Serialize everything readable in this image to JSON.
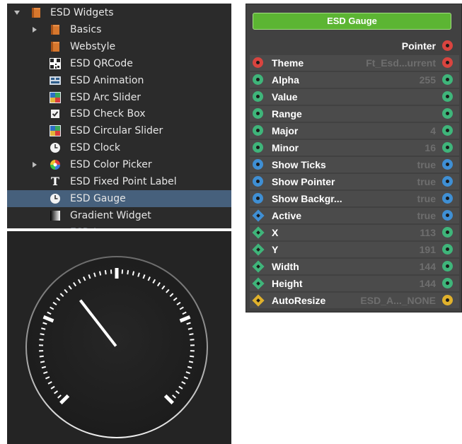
{
  "colors": {
    "red": "#d9443f",
    "green": "#3fb57a",
    "blue": "#3f8fd4",
    "yellow": "#e0b12c",
    "node_title": "#5cb533"
  },
  "tree": {
    "items": [
      {
        "label": "ESD Widgets",
        "icon": "book-icon",
        "arrow": "down",
        "level": 0
      },
      {
        "label": "Basics",
        "icon": "book-icon",
        "arrow": "right",
        "level": 1
      },
      {
        "label": "Webstyle",
        "icon": "book-icon",
        "arrow": "",
        "level": 1
      },
      {
        "label": "ESD QRCode",
        "icon": "qrcode-icon",
        "arrow": "",
        "level": 1
      },
      {
        "label": "ESD Animation",
        "icon": "animation-icon",
        "arrow": "",
        "level": 1
      },
      {
        "label": "ESD Arc Slider",
        "icon": "arc-slider-icon",
        "arrow": "",
        "level": 1
      },
      {
        "label": "ESD Check Box",
        "icon": "checkbox-icon",
        "arrow": "",
        "level": 1
      },
      {
        "label": "ESD Circular Slider",
        "icon": "circular-slider-icon",
        "arrow": "",
        "level": 1
      },
      {
        "label": "ESD Clock",
        "icon": "clock-icon",
        "arrow": "",
        "level": 1
      },
      {
        "label": "ESD Color Picker",
        "icon": "color-wheel-icon",
        "arrow": "right",
        "level": 1
      },
      {
        "label": "ESD Fixed Point Label",
        "icon": "text-icon",
        "arrow": "",
        "level": 1
      },
      {
        "label": "ESD Gauge",
        "icon": "gauge-icon",
        "arrow": "",
        "level": 1,
        "selected": true
      },
      {
        "label": "Gradient Widget",
        "icon": "gradient-icon",
        "arrow": "",
        "level": 1
      }
    ],
    "partial_label": "ESD L..."
  },
  "node": {
    "title": "ESD Gauge",
    "output": {
      "label": "Pointer",
      "port": "red"
    },
    "properties": [
      {
        "name": "Theme",
        "value": "Ft_Esd...urrent",
        "port": "red",
        "shape": "circle"
      },
      {
        "name": "Alpha",
        "value": "255",
        "port": "green",
        "shape": "circle"
      },
      {
        "name": "Value",
        "value": "",
        "port": "green",
        "shape": "circle"
      },
      {
        "name": "Range",
        "value": "",
        "port": "green",
        "shape": "circle"
      },
      {
        "name": "Major",
        "value": "4",
        "port": "green",
        "shape": "circle"
      },
      {
        "name": "Minor",
        "value": "16",
        "port": "green",
        "shape": "circle"
      },
      {
        "name": "Show Ticks",
        "value": "true",
        "port": "blue",
        "shape": "circle"
      },
      {
        "name": "Show Pointer",
        "value": "true",
        "port": "blue",
        "shape": "circle"
      },
      {
        "name": "Show Backgr...",
        "value": "true",
        "port": "blue",
        "shape": "circle"
      },
      {
        "name": "Active",
        "value": "true",
        "port": "blue",
        "shape": "diamond"
      },
      {
        "name": "X",
        "value": "113",
        "port": "green",
        "shape": "diamond"
      },
      {
        "name": "Y",
        "value": "191",
        "port": "green",
        "shape": "diamond"
      },
      {
        "name": "Width",
        "value": "144",
        "port": "green",
        "shape": "diamond"
      },
      {
        "name": "Height",
        "value": "144",
        "port": "green",
        "shape": "diamond"
      },
      {
        "name": "AutoResize",
        "value": "ESD_A..._NONE",
        "port": "yellow",
        "shape": "diamond"
      }
    ]
  },
  "gauge": {
    "major_ticks": 4,
    "minor_ticks": 16,
    "pointer_fraction": 0.36
  }
}
